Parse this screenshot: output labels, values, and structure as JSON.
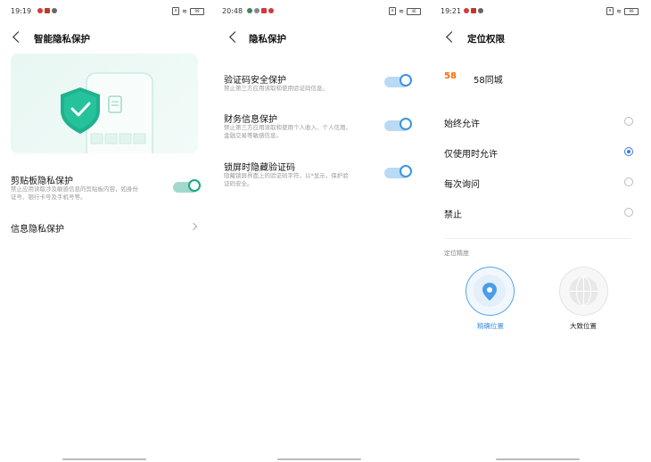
{
  "screen1": {
    "status": {
      "time": "19:19",
      "battery": "99"
    },
    "title": "智能隐私保护",
    "clipboard": {
      "title": "剪贴板隐私保护",
      "desc_line1": "禁止应用读取涉及敏感信息的剪贴板内容，如身份",
      "desc_line2": "证号、银行卡号及手机号等。",
      "enabled": true
    },
    "info_protection": {
      "title": "信息隐私保护"
    }
  },
  "screen2": {
    "status": {
      "time": "20:48",
      "battery": "46"
    },
    "title": "隐私保护",
    "items": [
      {
        "title": "验证码安全保护",
        "desc_line1": "禁止第三方应用读取和使用验证码信息。",
        "desc_line2": "",
        "enabled": true
      },
      {
        "title": "财务信息保护",
        "desc_line1": "禁止第三方应用读取和使用个人收入、个人信用、",
        "desc_line2": "金融交易等敏感信息。",
        "enabled": true
      },
      {
        "title": "锁屏时隐藏验证码",
        "desc_line1": "隐藏锁屏界面上的验证码字符，以*显示，保护验",
        "desc_line2": "证码安全。",
        "enabled": true
      }
    ]
  },
  "screen3": {
    "status": {
      "time": "19:21",
      "battery": "99"
    },
    "title": "定位权限",
    "app": {
      "logo_text": "58",
      "name": "58同城"
    },
    "options": [
      {
        "label": "始终允许",
        "selected": false
      },
      {
        "label": "仅使用时允许",
        "selected": true
      },
      {
        "label": "每次询问",
        "selected": false
      },
      {
        "label": "禁止",
        "selected": false
      }
    ],
    "accuracy_label": "定位精度",
    "precise_label": "精确位置",
    "approx_label": "大致位置"
  },
  "colors": {
    "green_accent": "#1aa784",
    "blue_accent": "#3a95e0",
    "radio_accent": "#3a7be0"
  },
  "icons": [
    "back-arrow-icon",
    "shield-check-icon",
    "chevron-right-icon",
    "location-pin-icon",
    "globe-icon",
    "wifi-icon",
    "battery-icon"
  ]
}
